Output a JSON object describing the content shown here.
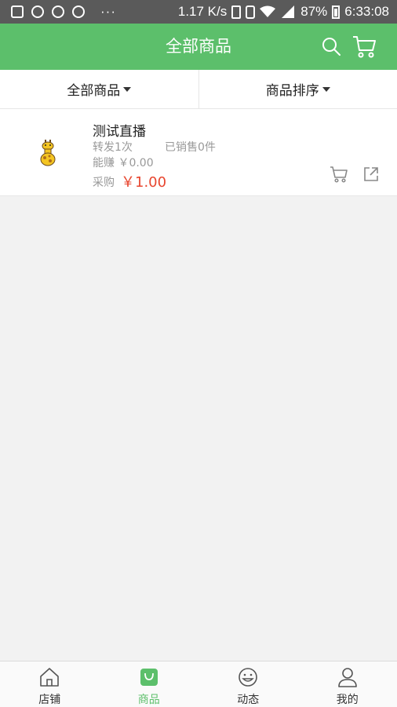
{
  "status_bar": {
    "speed": "1.17 K/s",
    "battery": "87%",
    "time": "6:33:08",
    "dots": "···"
  },
  "header": {
    "title": "全部商品",
    "bg_color": "#5cbf6b"
  },
  "filters": {
    "category_label": "全部商品",
    "sort_label": "商品排序"
  },
  "products": [
    {
      "name": "测试直播",
      "forward": "转发1次",
      "sold": "已销售0件",
      "earn": "能赚 ￥0.00",
      "buy_label": "采购",
      "price": "￥1.00"
    }
  ],
  "tabs": [
    {
      "label": "店铺",
      "icon": "home-icon"
    },
    {
      "label": "商品",
      "icon": "bag-icon",
      "active": true
    },
    {
      "label": "动态",
      "icon": "smile-icon"
    },
    {
      "label": "我的",
      "icon": "user-icon"
    }
  ],
  "colors": {
    "accent": "#5cbf6b",
    "price": "#e8462f"
  }
}
